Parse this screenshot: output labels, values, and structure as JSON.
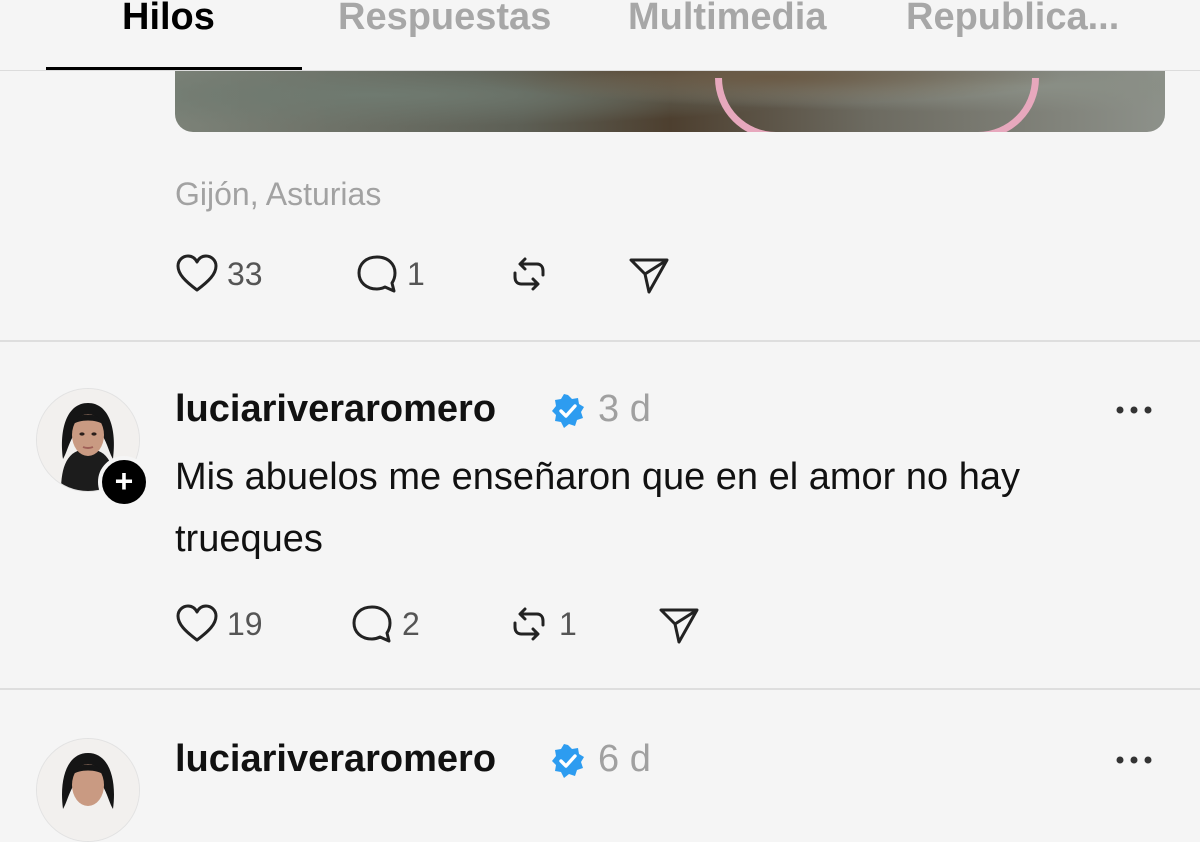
{
  "tabs": [
    {
      "label": "Hilos",
      "active": true
    },
    {
      "label": "Respuestas",
      "active": false
    },
    {
      "label": "Multimedia",
      "active": false
    },
    {
      "label": "Republica...",
      "active": false
    }
  ],
  "prev_post": {
    "location": "Gijón, Asturias",
    "likes": "33",
    "replies": "1",
    "reposts": "",
    "icons": [
      "heart-icon",
      "comment-icon",
      "repost-icon",
      "share-icon"
    ]
  },
  "posts": [
    {
      "username": "luciariveraromero",
      "verified": true,
      "time": "3 d",
      "text": "Mis abuelos me enseñaron que en el amor no hay trueques",
      "likes": "19",
      "replies": "2",
      "reposts": "1"
    },
    {
      "username": "luciariveraromero",
      "verified": true,
      "time": "6 d"
    }
  ],
  "colors": {
    "background": "#f5f5f5",
    "verified_blue": "#2d9cf0",
    "muted_text": "#a0a0a0"
  }
}
